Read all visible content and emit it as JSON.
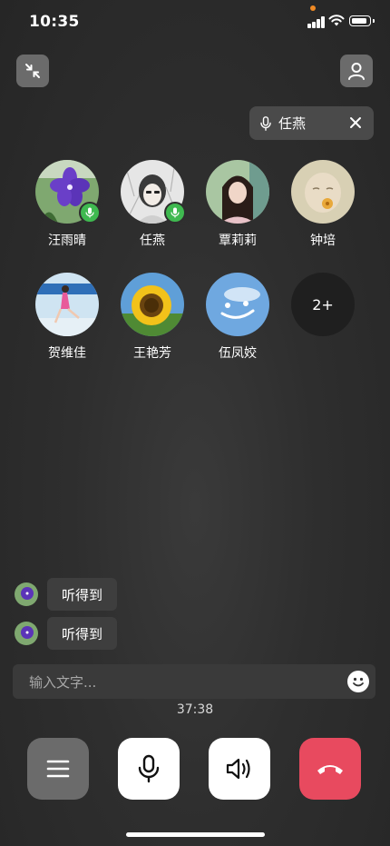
{
  "status_bar": {
    "time": "10:35"
  },
  "speaker": {
    "name": "任燕"
  },
  "participants": [
    {
      "name": "汪雨晴",
      "mic": true
    },
    {
      "name": "任燕",
      "mic": true
    },
    {
      "name": "覃莉莉",
      "mic": false
    },
    {
      "name": "钟培",
      "mic": false
    },
    {
      "name": "贺维佳",
      "mic": false
    },
    {
      "name": "王艳芳",
      "mic": false
    },
    {
      "name": "伍凤姣",
      "mic": false
    }
  ],
  "more_participants": "2+",
  "messages": [
    {
      "text": "听得到"
    },
    {
      "text": "听得到"
    }
  ],
  "input": {
    "placeholder": "输入文字..."
  },
  "call_timer": "37:38",
  "colors": {
    "hangup": "#e84a5f",
    "mic_badge": "#3fb950",
    "status_dot": "#f08a24"
  },
  "icons": [
    "collapse-icon",
    "user-icon",
    "mic-icon",
    "close-icon",
    "menu-icon",
    "speaker-icon",
    "hangup-icon",
    "emoji-icon"
  ]
}
